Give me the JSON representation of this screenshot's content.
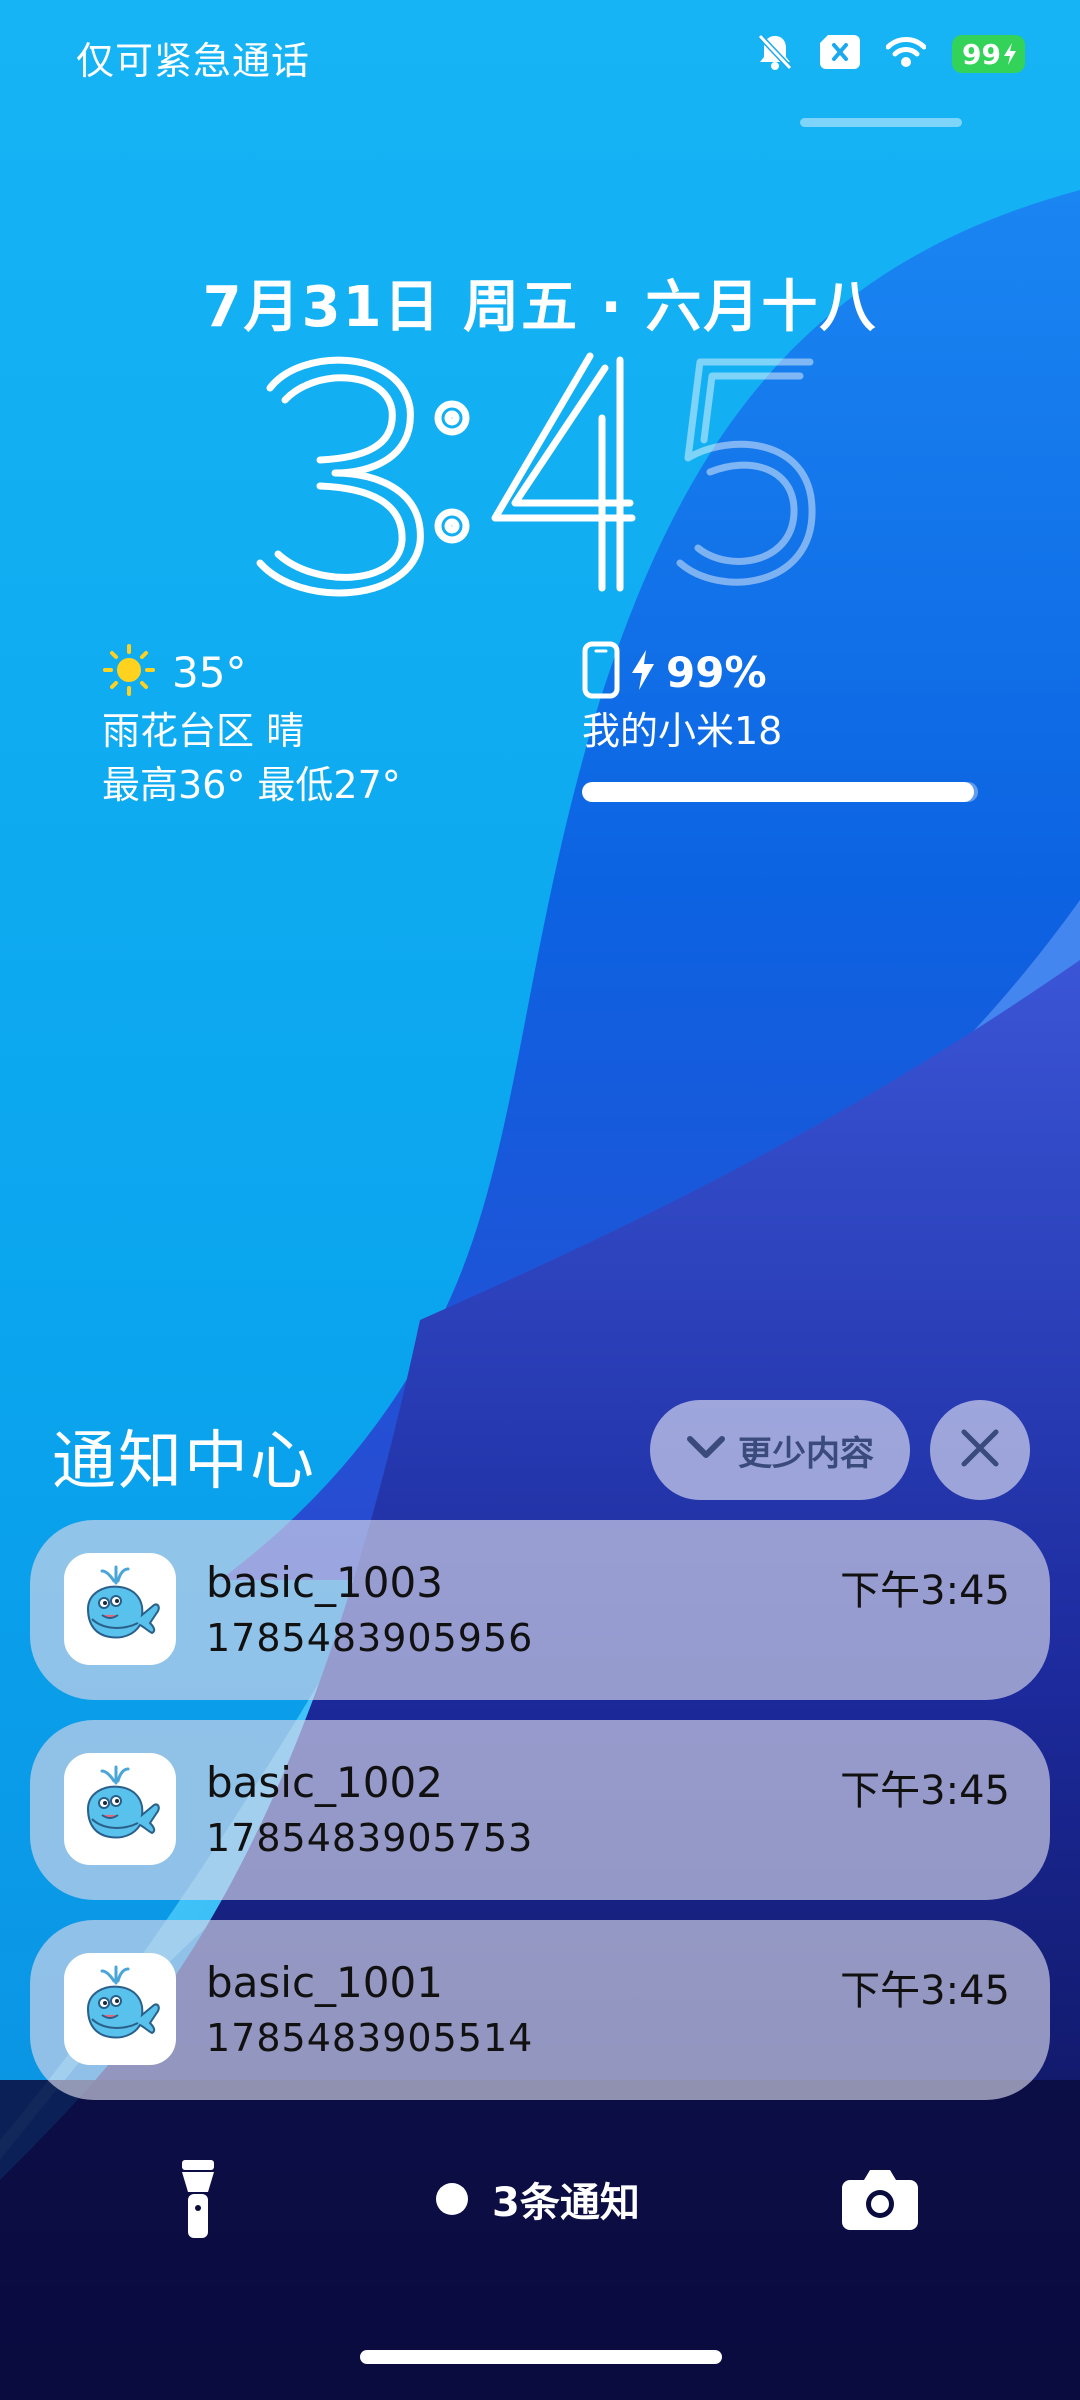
{
  "status_bar": {
    "text": "仅可紧急通话",
    "battery_percent": "99",
    "icons": [
      "mute-bell-icon",
      "sim-off-icon",
      "wifi-icon",
      "battery-charging-icon"
    ]
  },
  "lockscreen": {
    "date": "7月31日 周五 · 六月十八",
    "time": "3:45"
  },
  "weather": {
    "icon": "sun-icon",
    "temperature": "35°",
    "location_condition": "雨花台区 晴",
    "high_low": "最高36° 最低27°"
  },
  "device_battery": {
    "icon": "phone-outline-icon",
    "percent_text": "99%",
    "device_name": "我的小米18",
    "level": 0.99
  },
  "notification_center": {
    "title": "通知中心",
    "collapse_label": "更少内容",
    "notifications": [
      {
        "title": "basic_1003",
        "body": "1785483905956",
        "time": "下午3:45"
      },
      {
        "title": "basic_1002",
        "body": "1785483905753",
        "time": "下午3:45"
      },
      {
        "title": "basic_1001",
        "body": "1785483905514",
        "time": "下午3:45"
      }
    ]
  },
  "bottom_bar": {
    "notification_count": "3条通知",
    "left_icon": "flashlight-icon",
    "right_icon": "camera-icon"
  },
  "colors": {
    "sky_top": "#0aa8ee",
    "deep_blue": "#0a64e0",
    "navy": "#0b0f4a",
    "battery_green": "#33d35a"
  }
}
